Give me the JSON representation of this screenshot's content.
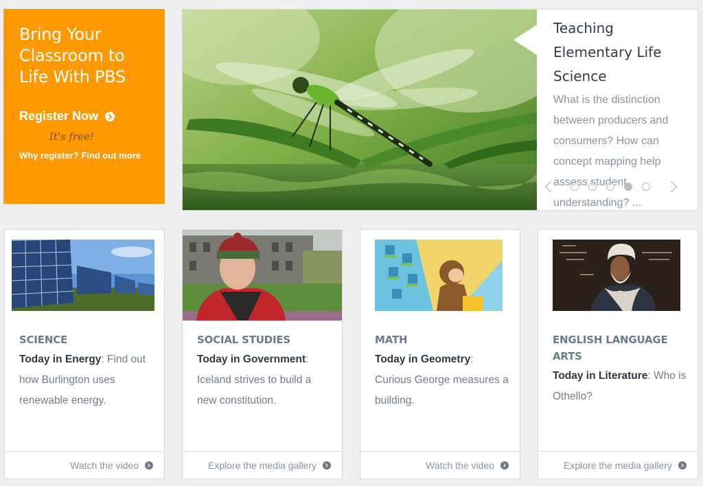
{
  "promo": {
    "title": "Bring Your Classroom to Life With PBS",
    "register_label": "Register Now",
    "free_note": "It's free!",
    "why_link": "Why register? Find out more"
  },
  "hero": {
    "title": "Teaching Elementary Life Science",
    "description": "What is the distinction between producers and consumers? How can concept mapping help assess student understanding? ...",
    "image_icon": "dragonfly-photo",
    "dots_total": 5,
    "active_dot": 4
  },
  "cards": [
    {
      "category": "SCIENCE",
      "lead": "Today in Energy",
      "text": ": Find out how Burlington uses renewable energy.",
      "footer": "Watch the video",
      "image": "solar-panels-photo"
    },
    {
      "category": "SOCIAL STUDIES",
      "lead": "Today in Government",
      "text": ": Iceland strives to build a new constitution.",
      "footer": "Explore the media gallery",
      "image": "man-in-red-hat-photo"
    },
    {
      "category": "MATH",
      "lead": "Today in Geometry",
      "text": ": Curious George measures a building.",
      "footer": "Watch the video",
      "image": "curious-george-building-photo"
    },
    {
      "category": "ENGLISH LANGUAGE ARTS",
      "lead": "Today in Literature",
      "text": ": Who is Othello?",
      "footer": "Explore the media gallery",
      "image": "othello-portrait-photo"
    }
  ],
  "colors": {
    "accent": "#ff9900",
    "category": "#6a7b8e",
    "body_text": "#737c86"
  }
}
